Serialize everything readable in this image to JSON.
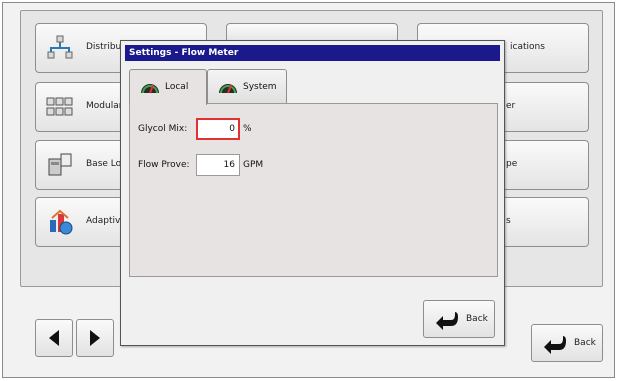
{
  "background_buttons": {
    "left": [
      {
        "label": "Distribut",
        "icon": "distribution-icon"
      },
      {
        "label": "Modular",
        "icon": "modular-icon"
      },
      {
        "label": "Base Loa",
        "icon": "base-load-icon"
      },
      {
        "label": "Adaptive",
        "icon": "adaptive-icon"
      }
    ],
    "right": [
      {
        "label": "ications"
      },
      {
        "label": "er"
      },
      {
        "label": "pe"
      },
      {
        "label": "s"
      }
    ]
  },
  "back_label": "Back",
  "dialog": {
    "title": "Settings - Flow Meter",
    "tabs": [
      {
        "label": "Local",
        "icon": "gauge-icon",
        "active": true
      },
      {
        "label": "System",
        "icon": "gauge-icon",
        "active": false
      }
    ],
    "fields": {
      "glycol_mix": {
        "label": "Glycol Mix:",
        "value": "0",
        "unit": "%"
      },
      "flow_prove": {
        "label": "Flow Prove:",
        "value": "16",
        "unit": "GPM"
      }
    },
    "back_label": "Back"
  },
  "colors": {
    "title_bar": "#1a1a8c",
    "focus_border": "#e03030",
    "accent_arrow": "#1a1a1a"
  }
}
